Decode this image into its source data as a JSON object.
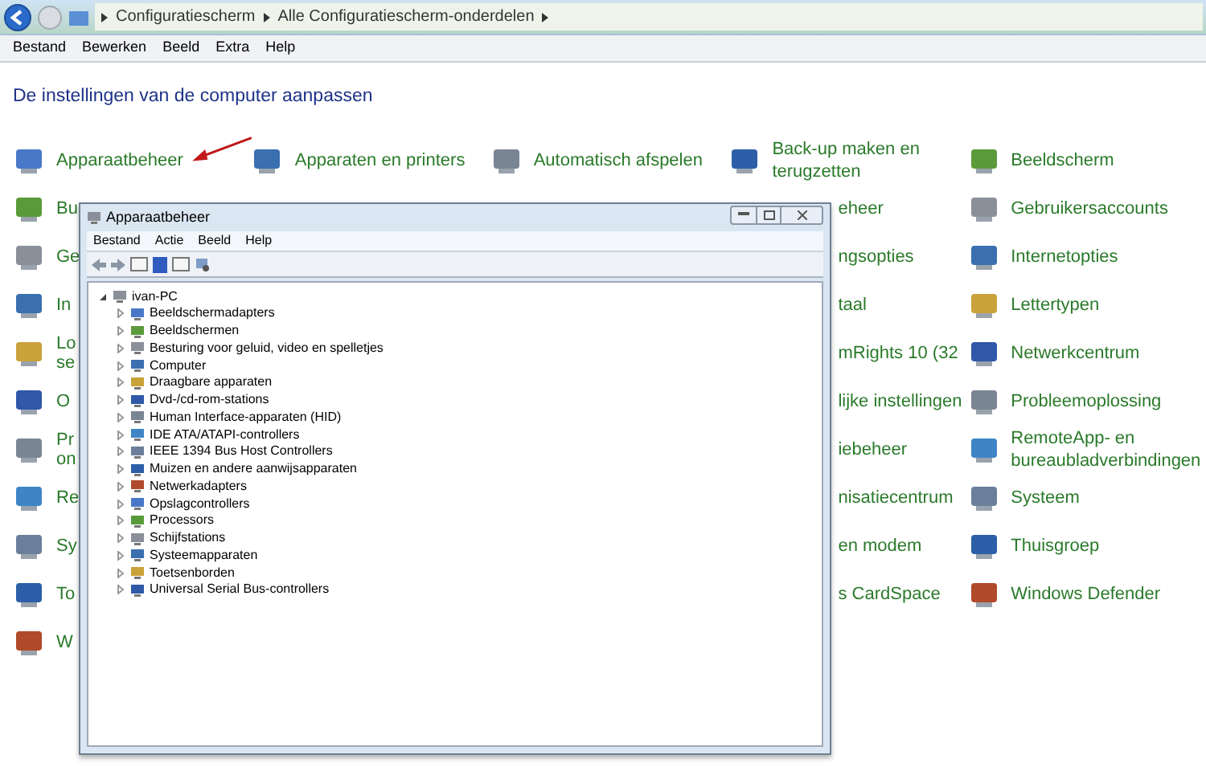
{
  "address_bar": {
    "breadcrumbs": [
      "Configuratiescherm",
      "Alle Configuratiescherm-onderdelen"
    ]
  },
  "menu": [
    "Bestand",
    "Bewerken",
    "Beeld",
    "Extra",
    "Help"
  ],
  "heading": "De instellingen van de computer aanpassen",
  "columns": [
    [
      {
        "kind": "full",
        "label": "Apparaatbeheer"
      },
      {
        "kind": "cut",
        "label": "Bu"
      },
      {
        "kind": "cut",
        "label": "Ge"
      },
      {
        "kind": "cut",
        "label": "In"
      },
      {
        "kind": "cut",
        "label": "Lo se"
      },
      {
        "kind": "cut",
        "label": "O"
      },
      {
        "kind": "cut",
        "label": "Pr on"
      },
      {
        "kind": "cut",
        "label": "Re"
      },
      {
        "kind": "cut",
        "label": "Sy"
      },
      {
        "kind": "cut",
        "label": "To"
      },
      {
        "kind": "cut",
        "label": "W"
      }
    ],
    [
      {
        "kind": "full",
        "label": "Apparaten en printers"
      }
    ],
    [
      {
        "kind": "full",
        "label": "Automatisch afspelen"
      }
    ],
    [
      {
        "kind": "full",
        "label": "Back-up maken en terugzetten"
      },
      {
        "kind": "cut",
        "label": "eheer"
      },
      {
        "kind": "cut",
        "label": "ngsopties"
      },
      {
        "kind": "cut",
        "label": "taal"
      },
      {
        "kind": "cut",
        "label": "mRights 10 (32"
      },
      {
        "kind": "cut",
        "label": "lijke instellingen"
      },
      {
        "kind": "cut",
        "label": "iebeheer"
      },
      {
        "kind": "cut",
        "label": "nisatiecentrum"
      },
      {
        "kind": "cut",
        "label": "en modem"
      },
      {
        "kind": "cut",
        "label": "s CardSpace"
      }
    ],
    [
      {
        "kind": "full",
        "label": "Beeldscherm"
      },
      {
        "kind": "full",
        "label": "Gebruikersaccounts"
      },
      {
        "kind": "full",
        "label": "Internetopties"
      },
      {
        "kind": "full",
        "label": "Lettertypen"
      },
      {
        "kind": "full",
        "label": "Netwerkcentrum"
      },
      {
        "kind": "full",
        "label": "Probleemoplossing"
      },
      {
        "kind": "full",
        "label": "RemoteApp- en bureaubladverbindingen"
      },
      {
        "kind": "full",
        "label": "Systeem"
      },
      {
        "kind": "full",
        "label": "Thuisgroep"
      },
      {
        "kind": "full",
        "label": "Windows Defender"
      }
    ]
  ],
  "device_manager": {
    "title": "Apparaatbeheer",
    "menu": [
      "Bestand",
      "Actie",
      "Beeld",
      "Help"
    ],
    "tree": {
      "label": "ivan-PC",
      "expanded": true,
      "children": [
        {
          "label": "Beeldschermadapters",
          "expanded": false
        },
        {
          "label": "Beeldschermen",
          "expanded": false
        },
        {
          "label": "Besturing voor geluid, video en spelletjes",
          "expanded": false
        },
        {
          "label": "Computer",
          "expanded": false
        },
        {
          "label": "Draagbare apparaten",
          "expanded": false
        },
        {
          "label": "Dvd-/cd-rom-stations",
          "expanded": false
        },
        {
          "label": "Human Interface-apparaten (HID)",
          "expanded": false
        },
        {
          "label": "IDE ATA/ATAPI-controllers",
          "expanded": false
        },
        {
          "label": "IEEE 1394 Bus Host Controllers",
          "expanded": false
        },
        {
          "label": "Muizen en andere aanwijsapparaten",
          "expanded": false
        },
        {
          "label": "Netwerkadapters",
          "expanded": false
        },
        {
          "label": "Opslagcontrollers",
          "expanded": false
        },
        {
          "label": "Processors",
          "expanded": false
        },
        {
          "label": "Schijfstations",
          "expanded": false
        },
        {
          "label": "Systeemapparaten",
          "expanded": false
        },
        {
          "label": "Toetsenborden",
          "expanded": false
        },
        {
          "label": "Universal Serial Bus-controllers",
          "expanded": false
        }
      ]
    }
  }
}
